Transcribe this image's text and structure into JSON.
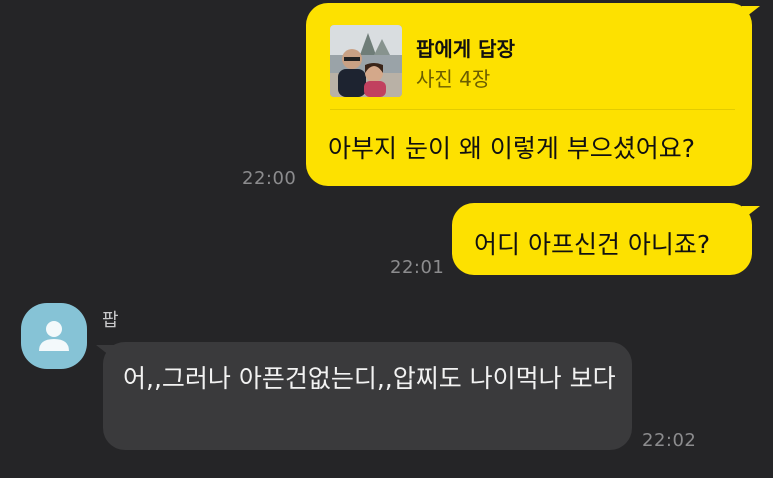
{
  "messages": [
    {
      "reply_title": "팝에게 답장",
      "reply_subtitle": "사진 4장",
      "text": "아부지 눈이 왜 이렇게 부으셨어요?",
      "time": "22:00"
    },
    {
      "text": "어디 아프신건 아니죠?",
      "time": "22:01"
    },
    {
      "sender": "팝",
      "text": "어,,그러나 아픈건없는디,,압찌도 나이먹나 보다",
      "time": "22:02"
    }
  ],
  "colors": {
    "background": "#252527",
    "outgoing_bubble": "#fde100",
    "incoming_bubble": "#3a3a3c",
    "avatar": "#86c3d6"
  },
  "icons": {
    "avatar": "default-person-icon",
    "reply_thumbnail": "photo-thumbnail"
  }
}
